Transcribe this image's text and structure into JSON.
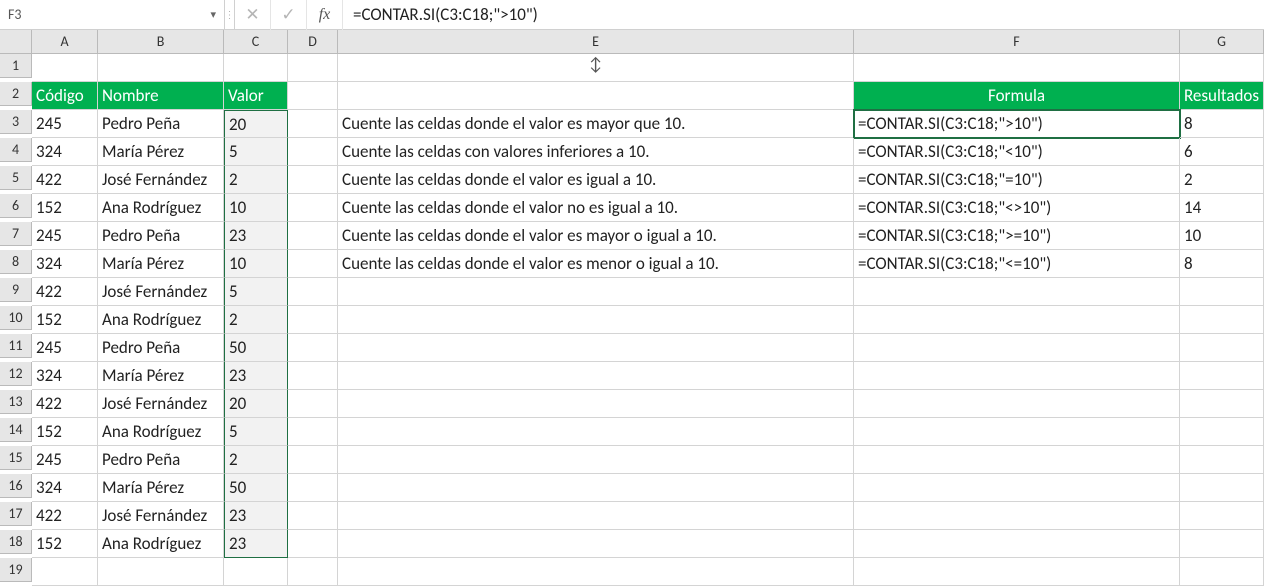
{
  "name_box": "F3",
  "formula": "=CONTAR.SI(C3:C18;\">10\")",
  "col_letters": [
    "A",
    "B",
    "C",
    "D",
    "E",
    "F",
    "G"
  ],
  "row_numbers": [
    "1",
    "2",
    "3",
    "4",
    "5",
    "6",
    "7",
    "8",
    "9",
    "10",
    "11",
    "12",
    "13",
    "14",
    "15",
    "16",
    "17",
    "18",
    "19"
  ],
  "resize_glyph": "↕",
  "headers": {
    "codigo": "Código",
    "nombre": "Nombre",
    "valor": "Valor",
    "formula": "Formula",
    "resultados": "Resultados"
  },
  "data_rows": [
    {
      "codigo": "245",
      "nombre": "Pedro Peña",
      "valor": "20"
    },
    {
      "codigo": "324",
      "nombre": "María Pérez",
      "valor": "5"
    },
    {
      "codigo": "422",
      "nombre": "José Fernández",
      "valor": "2"
    },
    {
      "codigo": "152",
      "nombre": "Ana Rodríguez",
      "valor": "10"
    },
    {
      "codigo": "245",
      "nombre": "Pedro Peña",
      "valor": "23"
    },
    {
      "codigo": "324",
      "nombre": "María Pérez",
      "valor": "10"
    },
    {
      "codigo": "422",
      "nombre": "José Fernández",
      "valor": "5"
    },
    {
      "codigo": "152",
      "nombre": "Ana Rodríguez",
      "valor": "2"
    },
    {
      "codigo": "245",
      "nombre": "Pedro Peña",
      "valor": "50"
    },
    {
      "codigo": "324",
      "nombre": "María Pérez",
      "valor": "23"
    },
    {
      "codigo": "422",
      "nombre": "José Fernández",
      "valor": "20"
    },
    {
      "codigo": "152",
      "nombre": "Ana Rodríguez",
      "valor": "5"
    },
    {
      "codigo": "245",
      "nombre": "Pedro Peña",
      "valor": "2"
    },
    {
      "codigo": "324",
      "nombre": "María Pérez",
      "valor": "50"
    },
    {
      "codigo": "422",
      "nombre": "José Fernández",
      "valor": "23"
    },
    {
      "codigo": "152",
      "nombre": "Ana Rodríguez",
      "valor": "23"
    }
  ],
  "desc_rows": [
    {
      "desc": "Cuente las celdas donde el valor es mayor que 10.",
      "formula": "=CONTAR.SI(C3:C18;\">10\")",
      "res": "8"
    },
    {
      "desc": "Cuente las celdas con valores inferiores a 10.",
      "formula": "=CONTAR.SI(C3:C18;\"<10\")",
      "res": "6"
    },
    {
      "desc": "Cuente las celdas donde el valor es igual a 10.",
      "formula": "=CONTAR.SI(C3:C18;\"=10\")",
      "res": "2"
    },
    {
      "desc": "Cuente las celdas donde el valor no es igual a 10.",
      "formula": "=CONTAR.SI(C3:C18;\"<>10\")",
      "res": "14"
    },
    {
      "desc": "Cuente las celdas donde el valor es mayor o igual a 10.",
      "formula": "=CONTAR.SI(C3:C18;\">=10\")",
      "res": "10"
    },
    {
      "desc": "Cuente las celdas donde el valor es menor o igual a 10.",
      "formula": "=CONTAR.SI(C3:C18;\"<=10\")",
      "res": "8"
    }
  ]
}
